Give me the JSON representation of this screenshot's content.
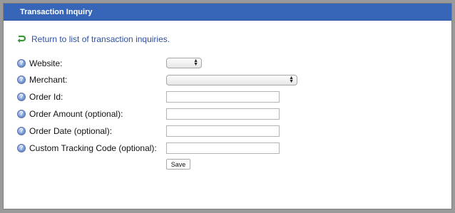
{
  "panel": {
    "title": "Transaction Inquiry"
  },
  "return_link": {
    "label": "Return to list of transaction inquiries."
  },
  "form": {
    "fields": [
      {
        "label": "Website:",
        "control": "select",
        "value": ""
      },
      {
        "label": "Merchant:",
        "control": "select",
        "value": ""
      },
      {
        "label": "Order Id:",
        "control": "text",
        "value": ""
      },
      {
        "label": "Order Amount (optional):",
        "control": "text",
        "value": ""
      },
      {
        "label": "Order Date (optional):",
        "control": "text",
        "value": ""
      },
      {
        "label": "Custom Tracking Code (optional):",
        "control": "text",
        "value": ""
      }
    ],
    "save_label": "Save"
  },
  "colors": {
    "header_bg": "#3766b8",
    "link": "#2f4f9e",
    "return_arrow": "#3a9a3a"
  },
  "icons": {
    "return": "return-arrow-icon",
    "help": "help-icon"
  }
}
